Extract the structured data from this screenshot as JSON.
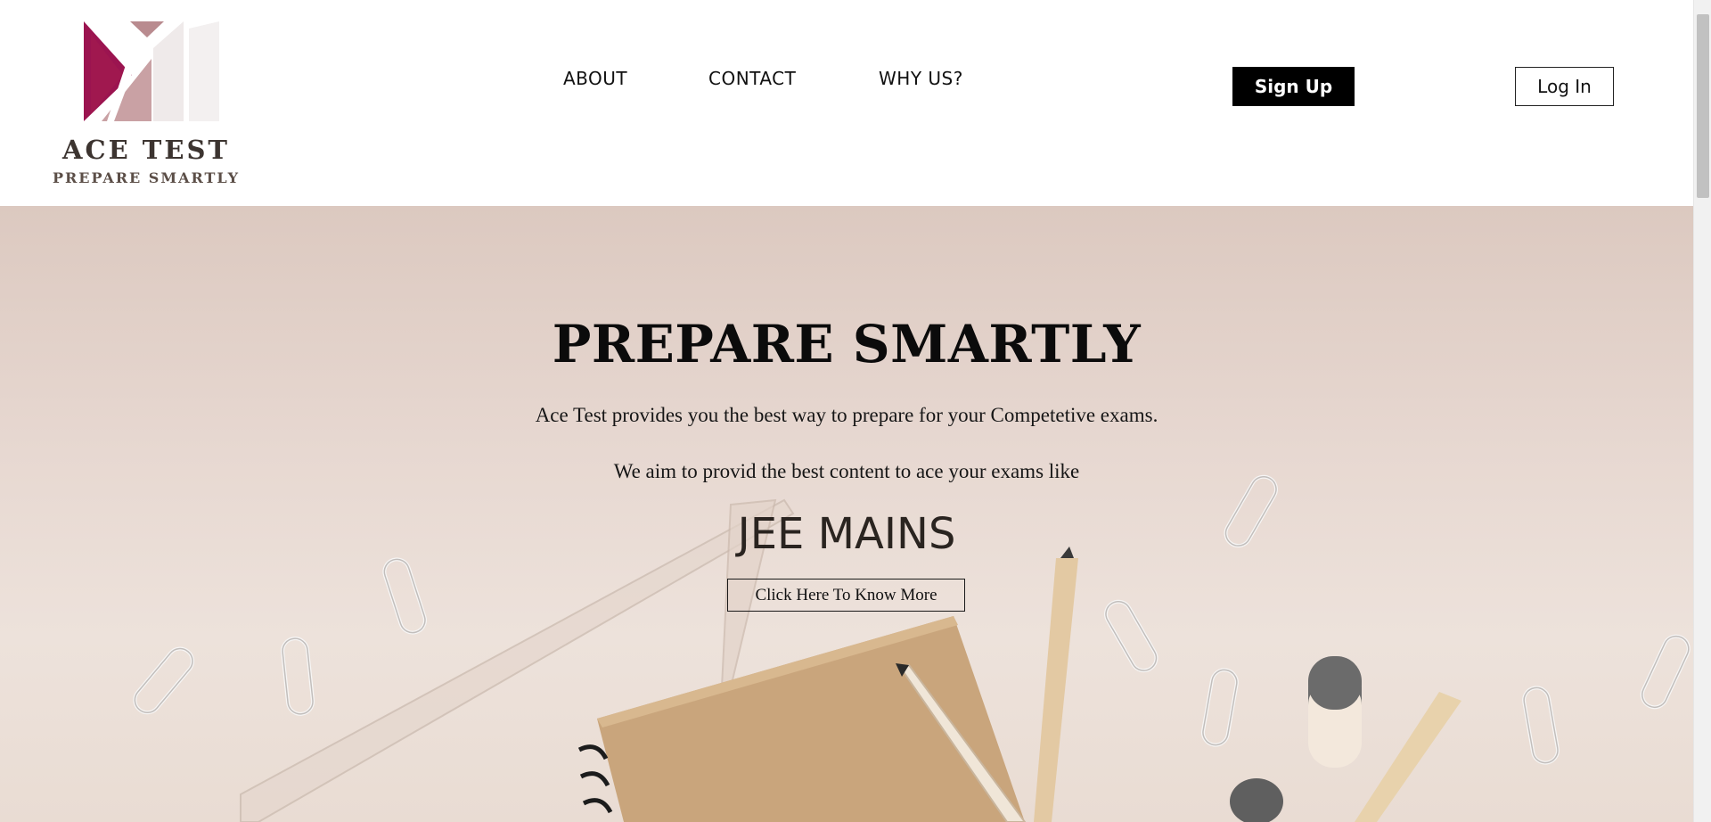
{
  "brand": {
    "name": "ACE TEST",
    "tagline": "PREPARE SMARTLY",
    "colors": {
      "primary": "#9b1450",
      "accent": "#b98b8f",
      "light": "#efeaea"
    }
  },
  "nav": {
    "links": [
      {
        "label": "ABOUT"
      },
      {
        "label": "CONTACT"
      },
      {
        "label": "WHY US?"
      }
    ],
    "signup_label": "Sign Up",
    "login_label": "Log In"
  },
  "hero": {
    "title": "PREPARE SMARTLY",
    "line1": "Ace Test provides you the best way to prepare for your Competetive exams.",
    "line2": "We aim to provid the best content to ace your exams like",
    "exam": "JEE MAINS",
    "cta_label": "Click Here To Know More"
  }
}
